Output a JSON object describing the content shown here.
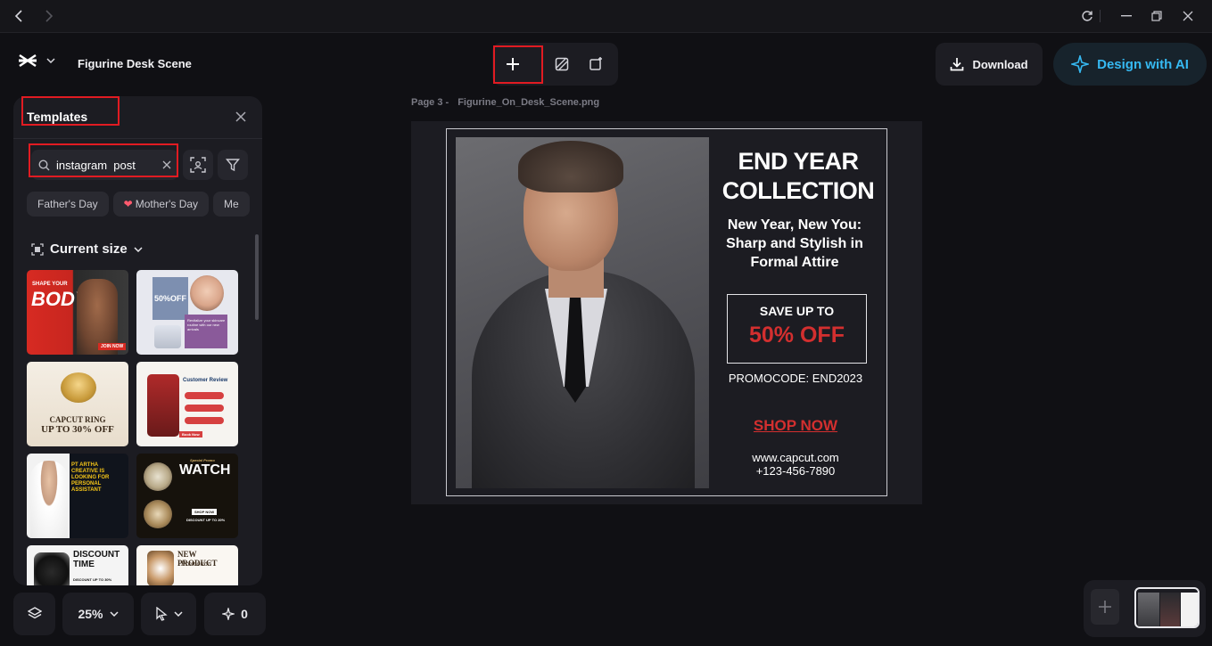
{
  "app": {
    "project_title": "Figurine Desk Scene"
  },
  "header": {
    "download_label": "Download",
    "ai_label": "Design with AI"
  },
  "panel": {
    "title": "Templates",
    "search_value": "instagram  post",
    "chips": [
      "Father's Day",
      "Mother's Day",
      "Me"
    ],
    "size_label": "Current size",
    "templates": [
      {
        "name": "shape-your-body",
        "title": "BODY",
        "subtitle": "SHAPE YOUR",
        "cta": "JOIN NOW"
      },
      {
        "name": "beauty-50off",
        "title": "50%OFF",
        "subtitle": "Revitalize your skincare routine with our new arrivals"
      },
      {
        "name": "capcut-ring",
        "title": "CAPCUT RING",
        "subtitle": "UP TO 30% OFF"
      },
      {
        "name": "customer-review",
        "title": "Customer Review",
        "cta": "Book Now"
      },
      {
        "name": "pt-artha",
        "title": "PT ARTHA CREATIVE IS LOOKING FOR PERSONAL ASSISTANT"
      },
      {
        "name": "watch",
        "title": "WATCH",
        "subtitle": "Special Promo",
        "cta": "SHOP NOW",
        "footer": "DISCOUNT UP TO 20%"
      },
      {
        "name": "discount-time",
        "title": "DISCOUNT TIME",
        "footer": "DISCOUNT UP TO 30%"
      },
      {
        "name": "new-product",
        "title": "NEW PRODUCT",
        "subtitle": "Promotion"
      }
    ]
  },
  "bottom_bar": {
    "zoom": "25%",
    "ai_count": "0"
  },
  "canvas": {
    "page_label": "Page 3 -",
    "file_name": "Figurine_On_Desk_Scene.png",
    "design": {
      "title_line1": "END YEAR",
      "title_line2": "COLLECTION",
      "subtitle_line1": "New Year, New You:",
      "subtitle_line2": "Sharp and Stylish in",
      "subtitle_line3": "Formal Attire",
      "save_label": "SAVE UP TO",
      "discount": "50% OFF",
      "promocode": "PROMOCODE: END2023",
      "shop_now": "SHOP NOW",
      "website": "www.capcut.com",
      "phone": "+123-456-7890"
    }
  },
  "colors": {
    "accent_red": "#d32f2f",
    "ai_blue": "#36b9f2",
    "highlight": "#e11b22"
  }
}
